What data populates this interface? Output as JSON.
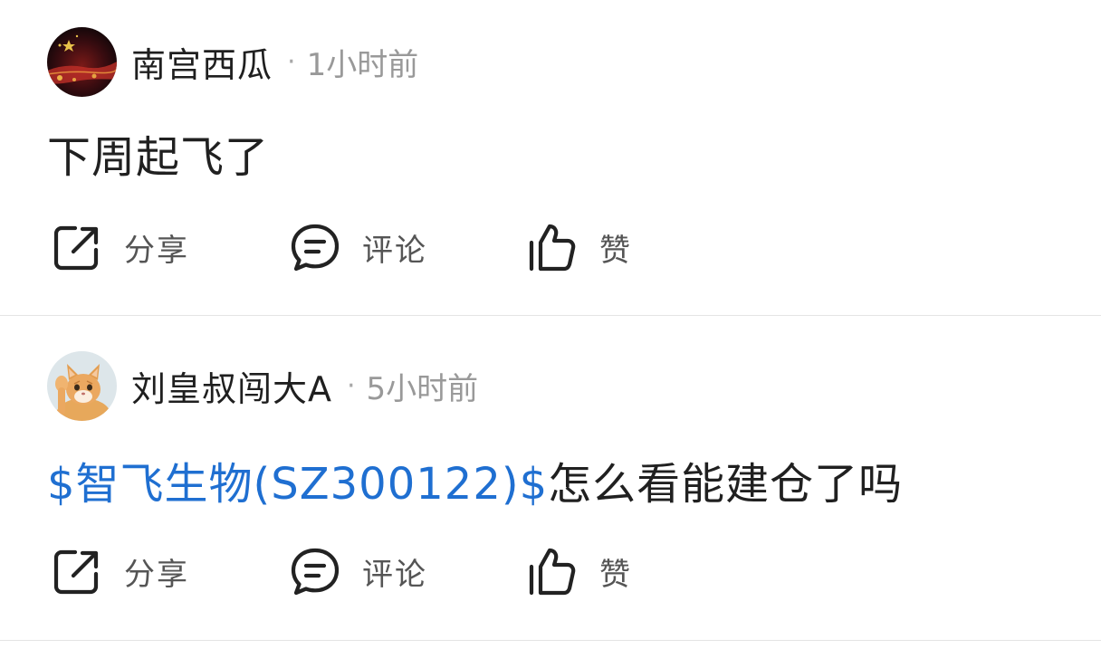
{
  "posts": [
    {
      "username": "南宫西瓜",
      "separator": "·",
      "time": "1小时前",
      "content": {
        "link_text": "",
        "text": "下周起飞了"
      },
      "actions": {
        "share": "分享",
        "comment": "评论",
        "like": "赞"
      }
    },
    {
      "username": "刘皇叔闯大A",
      "separator": "·",
      "time": "5小时前",
      "content": {
        "link_text": "$智飞生物(SZ300122)$",
        "text": "怎么看能建仓了吗"
      },
      "actions": {
        "share": "分享",
        "comment": "评论",
        "like": "赞"
      }
    }
  ],
  "icons": {
    "share": "share-icon",
    "comment": "comment-icon",
    "like": "thumbs-up-icon"
  },
  "colors": {
    "stock_link": "#1f6fd1",
    "username": "#1f1f1f",
    "timestamp": "#999999",
    "action_label": "#555555",
    "divider": "#e4e4e4"
  }
}
